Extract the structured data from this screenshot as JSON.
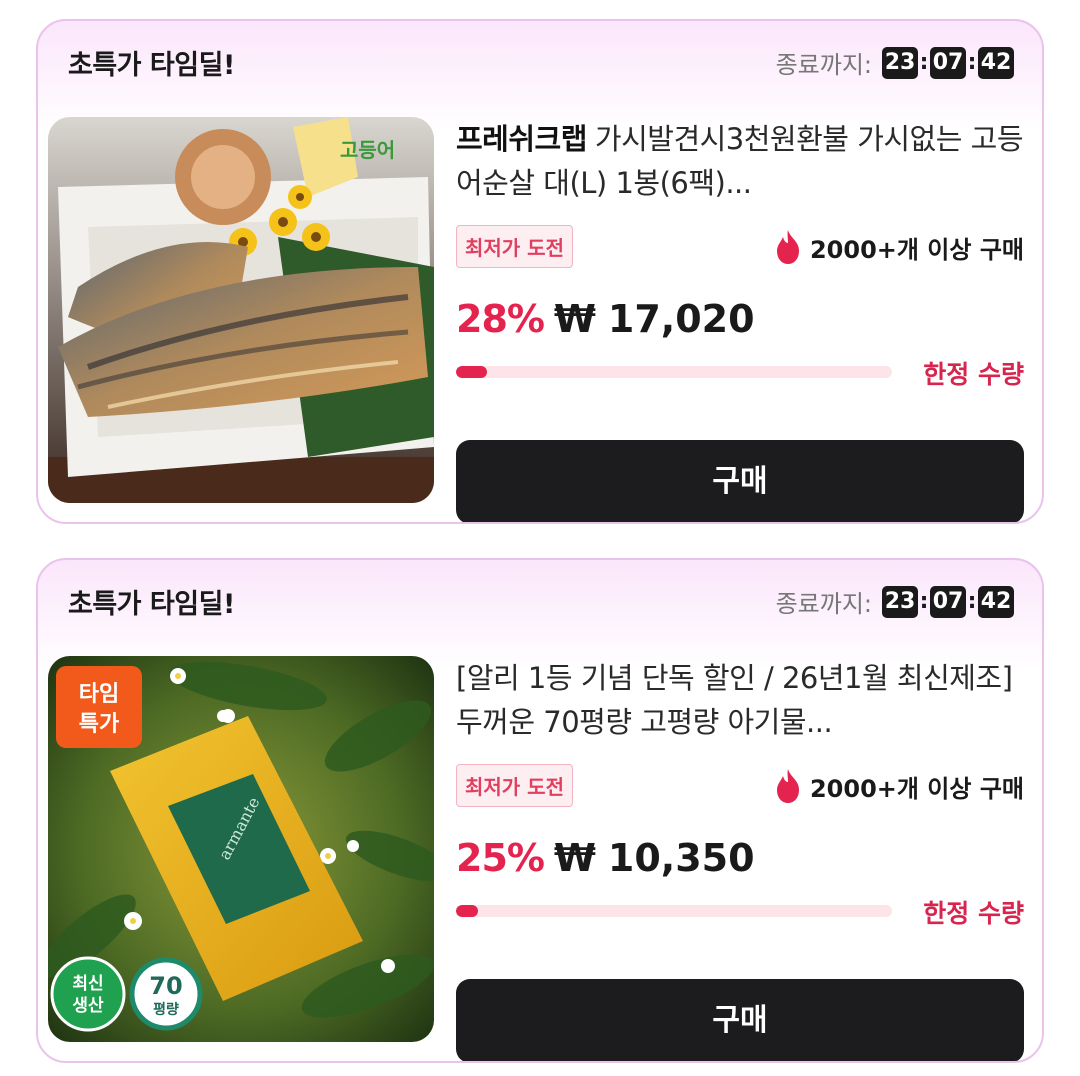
{
  "deals": [
    {
      "header_title": "초특가 타임딜!",
      "timer_label": "종료까지:",
      "timer": {
        "hours": "23",
        "minutes": "07",
        "seconds": "42"
      },
      "brand": "프레쉬크랩",
      "title": "가시발견시3천원환불 가시없는 고등어순살 대(L) 1봉(6팩)...",
      "badge": "최저가 도전",
      "purchase_count": "2000+개 이상 구매",
      "discount": "28%",
      "currency": "₩",
      "price": "17,020",
      "stock_progress": 0.07,
      "limited_label": "한정 수량",
      "buy_label": "구매",
      "image_icon": "grilled-mackerel-image"
    },
    {
      "header_title": "초특가 타임딜!",
      "timer_label": "종료까지:",
      "timer": {
        "hours": "23",
        "minutes": "07",
        "seconds": "42"
      },
      "brand": "",
      "title": "[알리 1등 기념 단독 할인 / 26년1월 최신제조] 두꺼운 70평량 고평량 아기물...",
      "badge": "최저가 도전",
      "purchase_count": "2000+개 이상 구매",
      "discount": "25%",
      "currency": "₩",
      "price": "10,350",
      "stock_progress": 0.05,
      "limited_label": "한정 수량",
      "buy_label": "구매",
      "image_icon": "baby-wipes-image",
      "image_badges": {
        "time_special": "타임\n특가",
        "new_production": "최신\n생산",
        "weight": "70",
        "weight_unit": "평량"
      }
    }
  ],
  "colors": {
    "accent": "#e4244f",
    "border": "#e9c3ec",
    "button": "#1c1c1e"
  }
}
